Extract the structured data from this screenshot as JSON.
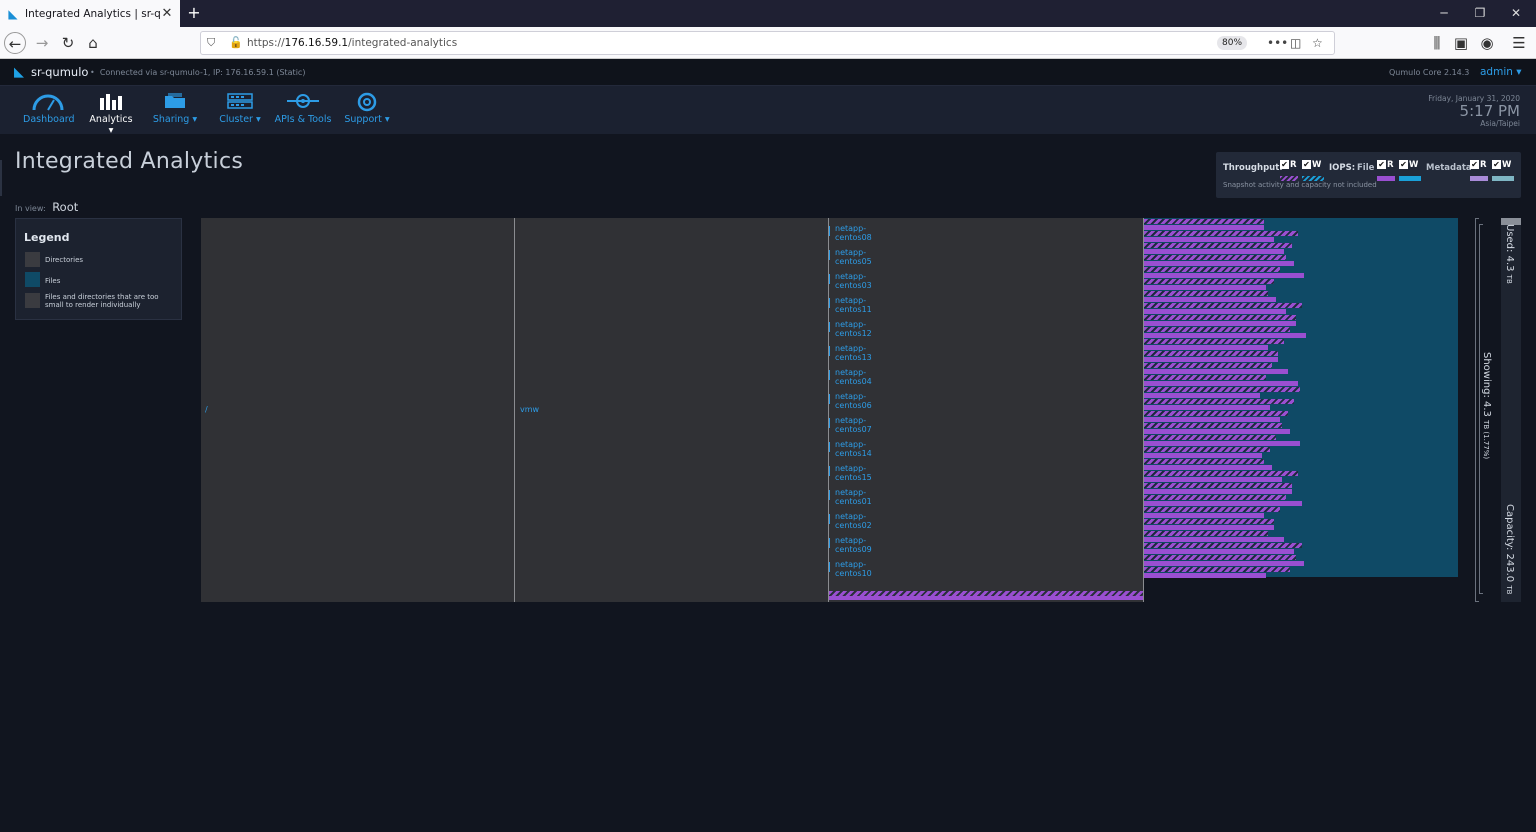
{
  "browser": {
    "tab_title": "Integrated Analytics | sr-qumulo",
    "url_prefix": "https://",
    "url_host": "176.16.59.1",
    "url_path": "/integrated-analytics",
    "zoom": "80%"
  },
  "header": {
    "cluster_name": "sr-qumulo",
    "connection": "Connected via sr-qumulo-1, IP: 176.16.59.1 (Static)",
    "version": "Qumulo Core 2.14.3",
    "user": "admin ▾"
  },
  "nav": {
    "items": [
      {
        "label": "Dashboard",
        "icon": "gauge-icon"
      },
      {
        "label": "Analytics ▾",
        "icon": "bar-chart-icon"
      },
      {
        "label": "Sharing ▾",
        "icon": "folder-share-icon"
      },
      {
        "label": "Cluster ▾",
        "icon": "server-icon"
      },
      {
        "label": "APIs & Tools",
        "icon": "api-icon"
      },
      {
        "label": "Support ▾",
        "icon": "lifebuoy-icon"
      }
    ],
    "date": "Friday, January 31, 2020",
    "time": "5:17 PM",
    "timezone": "Asia/Taipei"
  },
  "page": {
    "title": "Integrated Analytics",
    "in_view_label": "In view:",
    "in_view_value": "Root"
  },
  "filters": {
    "throughput_label": "Throughput:",
    "iops_label": "IOPS:",
    "file_label": "File",
    "metadata_label": "Metadata",
    "r": "R",
    "w": "W",
    "note": "Snapshot activity and capacity not included",
    "colors": {
      "read": "#9a4fd1",
      "write": "#1aa0d8",
      "meta_read": "#a98bd8",
      "meta_write": "#7fb6c4"
    }
  },
  "legend": {
    "title": "Legend",
    "items": [
      {
        "label": "Directories",
        "color": "#3a3b40"
      },
      {
        "label": "Files",
        "color": "#0f4a66"
      },
      {
        "label": "Files and directories that are too small to render individually",
        "color": "#3a3b40"
      }
    ]
  },
  "tree": {
    "root": "/",
    "level1": "vmw",
    "vms": [
      "netapp-centos08",
      "netapp-centos05",
      "netapp-centos03",
      "netapp-centos11",
      "netapp-centos12",
      "netapp-centos13",
      "netapp-centos04",
      "netapp-centos06",
      "netapp-centos07",
      "netapp-centos14",
      "netapp-centos15",
      "netapp-centos01",
      "netapp-centos02",
      "netapp-centos09",
      "netapp-centos10"
    ]
  },
  "capacity": {
    "used": "Used: 4.3",
    "used_unit": "TB",
    "showing": "Showing: 4.3",
    "showing_unit": "TB (1.77%)",
    "total": "Capacity: 243.0",
    "total_unit": "TB",
    "used_fraction": 0.0177
  }
}
